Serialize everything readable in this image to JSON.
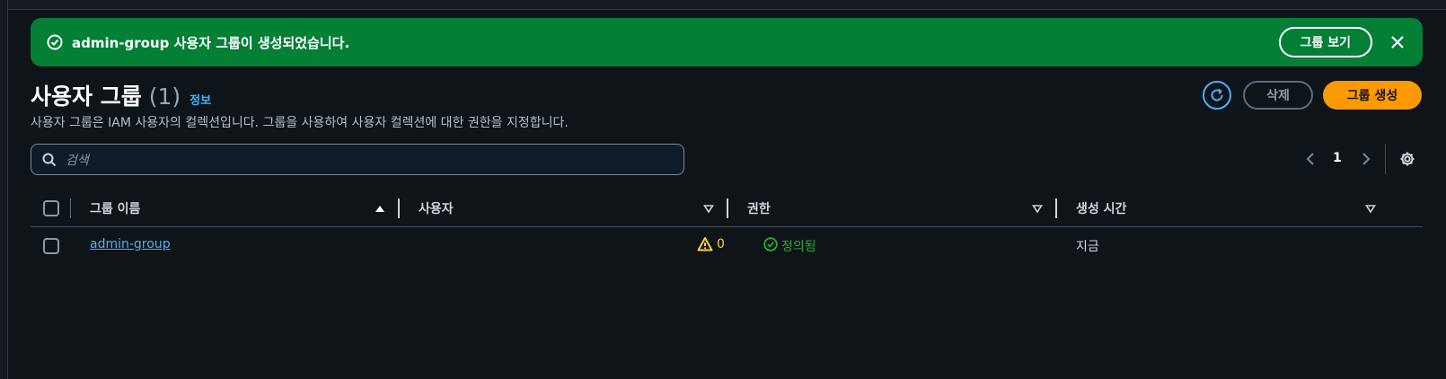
{
  "flash": {
    "message": "admin-group 사용자 그룹이 생성되었습니다.",
    "view_button": "그룹 보기",
    "icons": {
      "status": "check-circle-icon",
      "close": "close-icon"
    },
    "color": "#037f36"
  },
  "header": {
    "title": "사용자 그룹",
    "count": "(1)",
    "info_link": "정보",
    "description": "사용자 그룹은 IAM 사용자의 컬렉션입니다. 그룹을 사용하여 사용자 컬렉션에 대한 권한을 지정합니다.",
    "refresh_icon": "refresh-icon",
    "delete_button": "삭제",
    "create_button": "그룹 생성",
    "create_color": "#ff9900"
  },
  "search": {
    "placeholder": "검색",
    "icon": "search-icon"
  },
  "pagination": {
    "current_page": "1",
    "icons": {
      "prev": "chevron-left-icon",
      "next": "chevron-right-icon",
      "settings": "gear-icon"
    }
  },
  "table": {
    "columns": [
      {
        "label": "그룹 이름",
        "sort": "ascending"
      },
      {
        "label": "사용자",
        "sort": "none"
      },
      {
        "label": "권한",
        "sort": "none"
      },
      {
        "label": "생성 시간",
        "sort": "none"
      }
    ],
    "rows": [
      {
        "group_name": "admin-group",
        "users": "0",
        "users_status": "warning",
        "permissions": "정의됨",
        "permissions_status": "success",
        "created": "지금"
      }
    ]
  }
}
